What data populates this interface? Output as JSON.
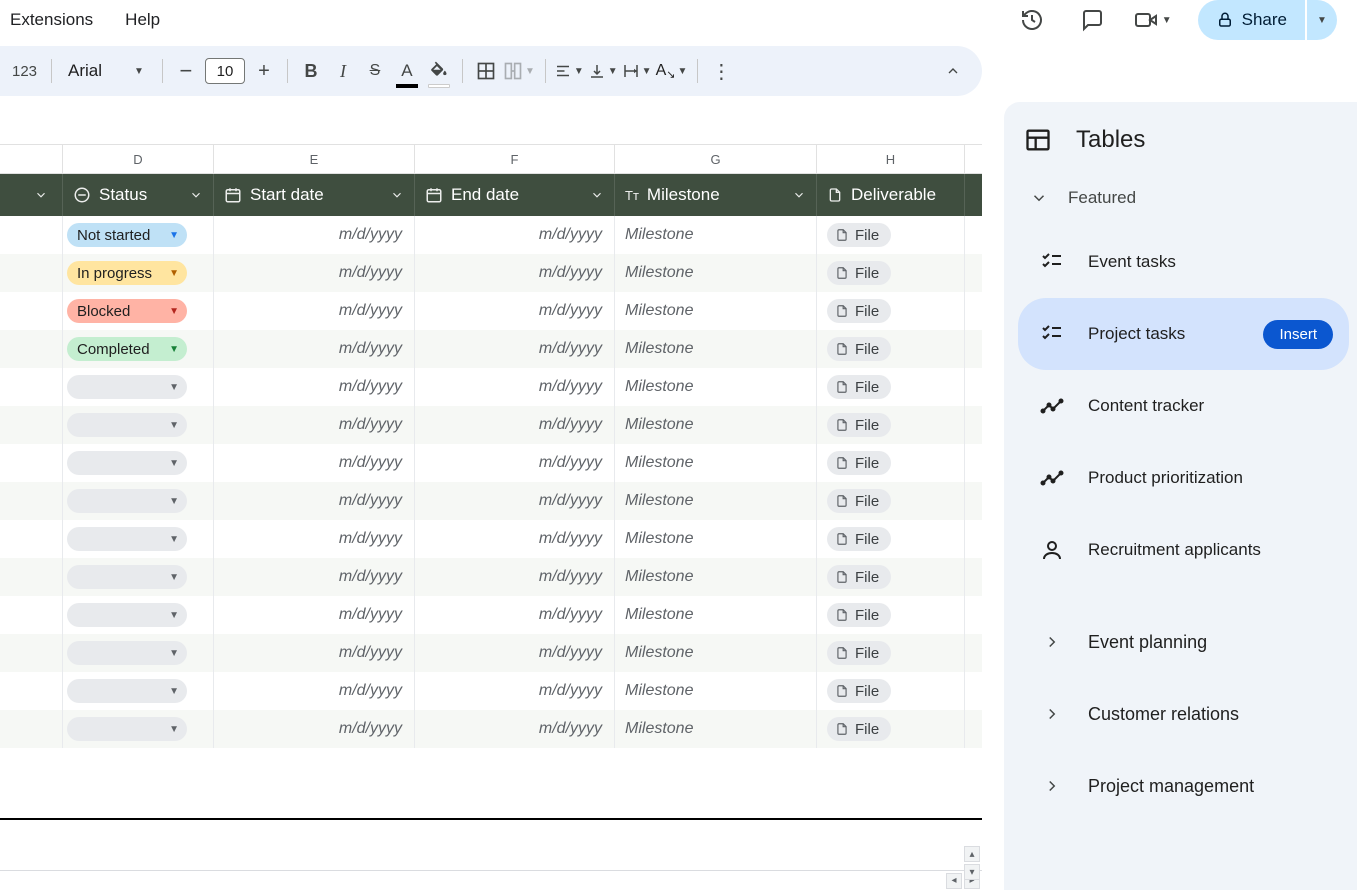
{
  "menus": {
    "extensions": "Extensions",
    "help": "Help"
  },
  "share_label": "Share",
  "toolbar": {
    "number_format": "123",
    "font": "Arial",
    "font_size": "10"
  },
  "columns": {
    "letters": [
      "D",
      "E",
      "F",
      "G",
      "H"
    ],
    "fields": [
      {
        "key": "status",
        "label": "Status",
        "icon": "status"
      },
      {
        "key": "start",
        "label": "Start date",
        "icon": "calendar"
      },
      {
        "key": "end",
        "label": "End date",
        "icon": "calendar"
      },
      {
        "key": "milestone",
        "label": "Milestone",
        "icon": "text"
      },
      {
        "key": "deliverable",
        "label": "Deliverable",
        "icon": "file"
      }
    ]
  },
  "placeholders": {
    "date": "m/d/yyyy",
    "milestone": "Milestone",
    "file": "File"
  },
  "status_options": [
    {
      "label": "Not started",
      "color": "blue"
    },
    {
      "label": "In progress",
      "color": "yellow"
    },
    {
      "label": "Blocked",
      "color": "red"
    },
    {
      "label": "Completed",
      "color": "green"
    }
  ],
  "row_count": 14,
  "panel": {
    "title": "Tables",
    "featured_label": "Featured",
    "insert_label": "Insert",
    "templates": [
      {
        "label": "Event tasks",
        "icon": "checklist"
      },
      {
        "label": "Project tasks",
        "icon": "checklist",
        "selected": true
      },
      {
        "label": "Content tracker",
        "icon": "trend"
      },
      {
        "label": "Product prioritization",
        "icon": "trend"
      },
      {
        "label": "Recruitment applicants",
        "icon": "person"
      }
    ],
    "categories": [
      "Event planning",
      "Customer relations",
      "Project management"
    ]
  }
}
